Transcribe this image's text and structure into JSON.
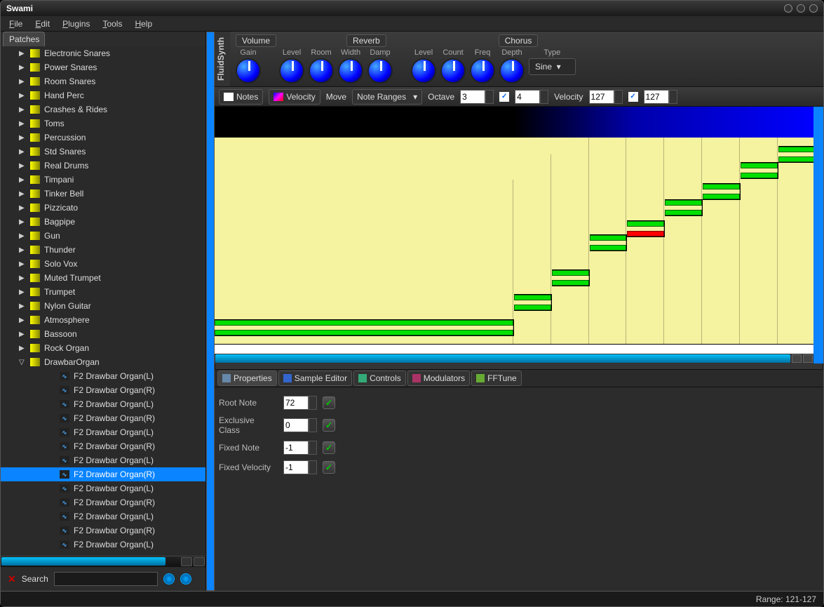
{
  "window": {
    "title": "Swami"
  },
  "menu": {
    "file": "File",
    "edit": "Edit",
    "plugins": "Plugins",
    "tools": "Tools",
    "help": "Help"
  },
  "sidebar": {
    "tab": "Patches",
    "instruments": [
      "Electronic Snares",
      "Power Snares",
      "Room Snares",
      "Hand Perc",
      "Crashes & Rides",
      "Toms",
      "Percussion",
      "Std Snares",
      "Real Drums",
      "Timpani",
      "Tinker Bell",
      "Pizzicato",
      "Bagpipe",
      "Gun",
      "Thunder",
      "Solo Vox",
      "Muted Trumpet",
      "Trumpet",
      "Nylon Guitar",
      "Atmosphere",
      "Bassoon",
      "Rock Organ"
    ],
    "expanded": "DrawbarOrgan",
    "children": [
      "F2 Drawbar Organ(L)",
      "F2 Drawbar Organ(R)",
      "F2 Drawbar Organ(L)",
      "F2 Drawbar Organ(R)",
      "F2 Drawbar Organ(L)",
      "F2 Drawbar Organ(R)",
      "F2 Drawbar Organ(L)",
      "F2 Drawbar Organ(R)",
      "F2 Drawbar Organ(L)",
      "F2 Drawbar Organ(R)",
      "F2 Drawbar Organ(L)",
      "F2 Drawbar Organ(R)",
      "F2 Drawbar Organ(L)"
    ],
    "selected_index": 7,
    "search_label": "Search"
  },
  "synth": {
    "panel": "FluidSynth",
    "volume": "Volume",
    "reverb": "Reverb",
    "chorus": "Chorus",
    "knobs_vol": [
      "Gain"
    ],
    "knobs_rev": [
      "Level",
      "Room",
      "Width",
      "Damp"
    ],
    "knobs_cho": [
      "Level",
      "Count",
      "Freq",
      "Depth"
    ],
    "type_label": "Type",
    "type_value": "Sine"
  },
  "toolbar": {
    "notes": "Notes",
    "velocity": "Velocity",
    "move": "Move",
    "note_ranges": "Note Ranges",
    "octave": "Octave",
    "oct_low": "3",
    "oct_high": "4",
    "velocity_label": "Velocity",
    "vel_low": "127",
    "vel_high": "127"
  },
  "tabs": {
    "properties": "Properties",
    "sample_editor": "Sample Editor",
    "controls": "Controls",
    "modulators": "Modulators",
    "fftune": "FFTune"
  },
  "props": {
    "root_note_label": "Root Note",
    "root_note": "72",
    "excl_label": "Exclusive Class",
    "excl": "0",
    "fixed_note_label": "Fixed Note",
    "fixed_note": "-1",
    "fixed_vel_label": "Fixed Velocity",
    "fixed_vel": "-1"
  },
  "status": "Range: 121-127"
}
